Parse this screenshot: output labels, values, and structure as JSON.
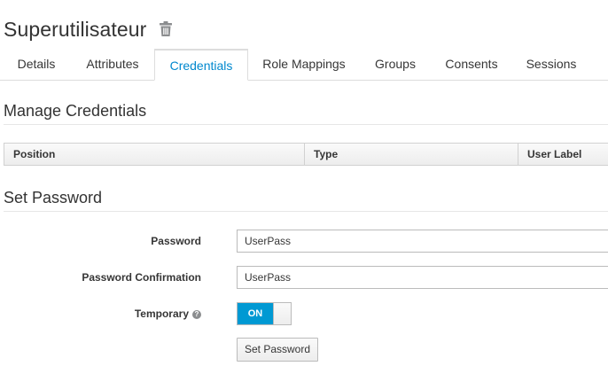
{
  "header": {
    "title": "Superutilisateur",
    "delete_icon": "trash-icon"
  },
  "tabs": [
    {
      "label": "Details",
      "active": false
    },
    {
      "label": "Attributes",
      "active": false
    },
    {
      "label": "Credentials",
      "active": true
    },
    {
      "label": "Role Mappings",
      "active": false
    },
    {
      "label": "Groups",
      "active": false
    },
    {
      "label": "Consents",
      "active": false
    },
    {
      "label": "Sessions",
      "active": false
    }
  ],
  "manage_credentials": {
    "title": "Manage Credentials",
    "columns": [
      "Position",
      "Type",
      "User Label"
    ]
  },
  "set_password": {
    "title": "Set Password",
    "password_label": "Password",
    "password_value": "UserPass",
    "confirmation_label": "Password Confirmation",
    "confirmation_value": "UserPass",
    "temporary_label": "Temporary",
    "help_icon": "question-circle-icon",
    "temporary_state": "ON",
    "submit_label": "Set Password"
  },
  "colors": {
    "accent": "#0088ce",
    "toggle_on": "#0099d3"
  }
}
